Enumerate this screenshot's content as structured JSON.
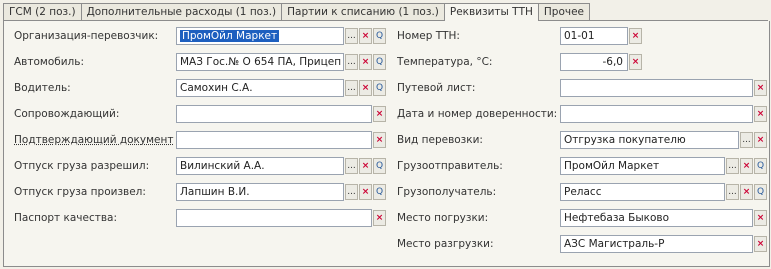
{
  "tabs": [
    {
      "label": "ГСМ (2 поз.)",
      "active": false
    },
    {
      "label": "Дополнительные расходы (1 поз.)",
      "active": false
    },
    {
      "label": "Партии к списанию (1 поз.)",
      "active": false
    },
    {
      "label": "Реквизиты ТТН",
      "active": true
    },
    {
      "label": "Прочее",
      "active": false
    }
  ],
  "left": {
    "carrier": {
      "label": "Организация-перевозчик:",
      "value": "ПромОйл Маркет"
    },
    "vehicle": {
      "label": "Автомобиль:",
      "value": "МАЗ Гос.№ О 654 ПА, Прицеп"
    },
    "driver": {
      "label": "Водитель:",
      "value": "Самохин С.А."
    },
    "escort": {
      "label": "Сопровождающий:",
      "value": ""
    },
    "confirm_doc": {
      "label": "Подтверждающий документ:",
      "value": ""
    },
    "release_allowed": {
      "label": "Отпуск груза разрешил:",
      "value": "Вилинский А.А."
    },
    "release_made": {
      "label": "Отпуск груза произвел:",
      "value": "Лапшин В.И."
    },
    "quality_passport": {
      "label": "Паспорт качества:",
      "value": ""
    }
  },
  "right": {
    "ttn_number": {
      "label": "Номер ТТН:",
      "value": "01-01"
    },
    "temperature": {
      "label": "Температура, °С:",
      "value": "-6,0"
    },
    "waybill": {
      "label": "Путевой лист:",
      "value": ""
    },
    "power_of_attorney": {
      "label": "Дата и номер доверенности:",
      "value": ""
    },
    "transport_type": {
      "label": "Вид перевозки:",
      "value": "Отгрузка покупателю"
    },
    "shipper": {
      "label": "Грузоотправитель:",
      "value": "ПромОйл Маркет"
    },
    "consignee": {
      "label": "Грузополучатель:",
      "value": "Реласс"
    },
    "loading_place": {
      "label": "Место погрузки:",
      "value": "Нефтебаза Быково"
    },
    "unloading_place": {
      "label": "Место разгрузки:",
      "value": "АЗС Магистраль-Р"
    }
  },
  "buttons": {
    "select": "...",
    "clear": "×",
    "open": "Q"
  }
}
